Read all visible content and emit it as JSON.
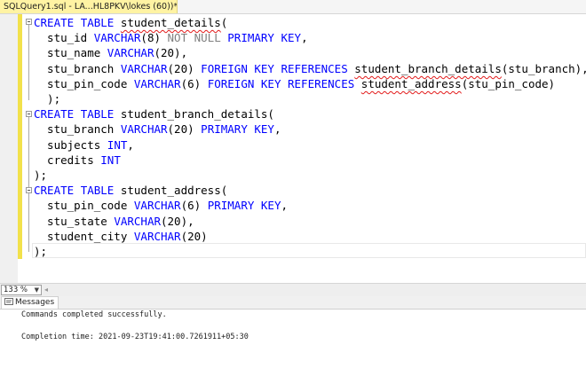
{
  "tab": {
    "title": "SQLQuery1.sql - LA...HL8PKV\\lokes (60))*"
  },
  "code_lines": [
    [
      {
        "t": "CREATE",
        "c": "kw"
      },
      {
        "t": " "
      },
      {
        "t": "TABLE",
        "c": "kw"
      },
      {
        "t": " "
      },
      {
        "t": "student_details",
        "c": "err"
      },
      {
        "t": "("
      }
    ],
    [
      {
        "t": "  stu_id "
      },
      {
        "t": "VARCHAR",
        "c": "kw"
      },
      {
        "t": "(8) "
      },
      {
        "t": "NOT NULL",
        "c": "gr"
      },
      {
        "t": " "
      },
      {
        "t": "PRIMARY KEY",
        "c": "kw"
      },
      {
        "t": ","
      }
    ],
    [
      {
        "t": "  stu_name "
      },
      {
        "t": "VARCHAR",
        "c": "kw"
      },
      {
        "t": "(20),"
      }
    ],
    [
      {
        "t": "  stu_branch "
      },
      {
        "t": "VARCHAR",
        "c": "kw"
      },
      {
        "t": "(20) "
      },
      {
        "t": "FOREIGN KEY REFERENCES",
        "c": "kw"
      },
      {
        "t": " "
      },
      {
        "t": "student_branch_details",
        "c": "err"
      },
      {
        "t": "(stu_branch),"
      }
    ],
    [
      {
        "t": "  stu_pin_code "
      },
      {
        "t": "VARCHAR",
        "c": "kw"
      },
      {
        "t": "(6) "
      },
      {
        "t": "FOREIGN KEY REFERENCES",
        "c": "kw"
      },
      {
        "t": " "
      },
      {
        "t": "student_address",
        "c": "err"
      },
      {
        "t": "(stu_pin_code)"
      }
    ],
    [
      {
        "t": "  );"
      }
    ],
    [
      {
        "t": "CREATE",
        "c": "kw"
      },
      {
        "t": " "
      },
      {
        "t": "TABLE",
        "c": "kw"
      },
      {
        "t": " student_branch_details("
      }
    ],
    [
      {
        "t": "  stu_branch "
      },
      {
        "t": "VARCHAR",
        "c": "kw"
      },
      {
        "t": "(20) "
      },
      {
        "t": "PRIMARY KEY",
        "c": "kw"
      },
      {
        "t": ","
      }
    ],
    [
      {
        "t": "  subjects "
      },
      {
        "t": "INT",
        "c": "kw"
      },
      {
        "t": ","
      }
    ],
    [
      {
        "t": "  credits "
      },
      {
        "t": "INT",
        "c": "kw"
      }
    ],
    [
      {
        "t": ");"
      }
    ],
    [
      {
        "t": "CREATE",
        "c": "kw"
      },
      {
        "t": " "
      },
      {
        "t": "TABLE",
        "c": "kw"
      },
      {
        "t": " student_address("
      }
    ],
    [
      {
        "t": "  stu_pin_code "
      },
      {
        "t": "VARCHAR",
        "c": "kw"
      },
      {
        "t": "(6) "
      },
      {
        "t": "PRIMARY KEY",
        "c": "kw"
      },
      {
        "t": ","
      }
    ],
    [
      {
        "t": "  stu_state "
      },
      {
        "t": "VARCHAR",
        "c": "kw"
      },
      {
        "t": "(20),"
      }
    ],
    [
      {
        "t": "  student_city "
      },
      {
        "t": "VARCHAR",
        "c": "kw"
      },
      {
        "t": "(20)"
      }
    ],
    [
      {
        "t": ");"
      }
    ]
  ],
  "zoom": {
    "value": "133 %"
  },
  "results": {
    "tab_label": "Messages"
  },
  "messages": {
    "line1": "Commands completed successfully.",
    "line2": "Completion time: 2021-09-23T19:41:00.7261911+05:30"
  },
  "colors": {
    "keyword": "#0000ff",
    "gray_keyword": "#808080",
    "change_bar": "#f2e14b",
    "tab": "#fff3a3"
  }
}
